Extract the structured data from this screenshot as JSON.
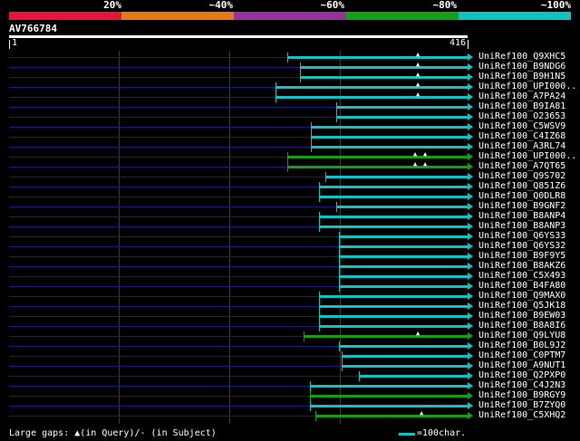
{
  "scale": {
    "labels": [
      "20%",
      "~40%",
      "~60%",
      "~80%",
      "~100%"
    ],
    "colors": [
      "#e8143a",
      "#e87814",
      "#9632a0",
      "#14a014",
      "#0dc3c3"
    ]
  },
  "query": {
    "name": "AV766784",
    "start": "1",
    "end": "416",
    "length": 416
  },
  "hits": [
    {
      "label": "UniRef100_Q9XHC5",
      "start": 252,
      "color": "#0dc3c3",
      "gaps": [
        372
      ]
    },
    {
      "label": "UniRef100_B9NDG6",
      "start": 264,
      "color": "#0dc3c3",
      "gaps": [
        372
      ]
    },
    {
      "label": "UniRef100_B9H1N5",
      "start": 264,
      "color": "#0dc3c3",
      "gaps": [
        372
      ]
    },
    {
      "label": "UniRef100_UPI000..",
      "start": 242,
      "color": "#0dc3c3",
      "gaps": [
        372
      ]
    },
    {
      "label": "UniRef100_A7PA24",
      "start": 242,
      "color": "#0dc3c3",
      "gaps": [
        372
      ]
    },
    {
      "label": "UniRef100_B9IA81",
      "start": 297,
      "color": "#0dc3c3",
      "gaps": []
    },
    {
      "label": "UniRef100_O23653",
      "start": 297,
      "color": "#0dc3c3",
      "gaps": []
    },
    {
      "label": "UniRef100_C5WSV9",
      "start": 274,
      "color": "#0dc3c3",
      "gaps": []
    },
    {
      "label": "UniRef100_C4IZ68",
      "start": 274,
      "color": "#0dc3c3",
      "gaps": []
    },
    {
      "label": "UniRef100_A3RL74",
      "start": 274,
      "color": "#0dc3c3",
      "gaps": []
    },
    {
      "label": "UniRef100_UPI000..",
      "start": 252,
      "color": "#14a014",
      "gaps": [
        369,
        378
      ]
    },
    {
      "label": "UniRef100_A7QT65",
      "start": 252,
      "color": "#14a014",
      "gaps": [
        369,
        378
      ]
    },
    {
      "label": "UniRef100_Q9S702",
      "start": 287,
      "color": "#0dc3c3",
      "gaps": []
    },
    {
      "label": "UniRef100_Q851Z6",
      "start": 281,
      "color": "#0dc3c3",
      "gaps": []
    },
    {
      "label": "UniRef100_Q0DLR8",
      "start": 281,
      "color": "#0dc3c3",
      "gaps": []
    },
    {
      "label": "UniRef100_B9GNF2",
      "start": 297,
      "color": "#0dc3c3",
      "gaps": []
    },
    {
      "label": "UniRef100_B8ANP4",
      "start": 281,
      "color": "#0dc3c3",
      "gaps": []
    },
    {
      "label": "UniRef100_B8ANP3",
      "start": 281,
      "color": "#0dc3c3",
      "gaps": []
    },
    {
      "label": "UniRef100_Q6YS33",
      "start": 299,
      "color": "#0dc3c3",
      "gaps": []
    },
    {
      "label": "UniRef100_Q6YS32",
      "start": 299,
      "color": "#0dc3c3",
      "gaps": []
    },
    {
      "label": "UniRef100_B9F9Y5",
      "start": 299,
      "color": "#0dc3c3",
      "gaps": []
    },
    {
      "label": "UniRef100_B8AKZ6",
      "start": 299,
      "color": "#0dc3c3",
      "gaps": []
    },
    {
      "label": "UniRef100_C5X493",
      "start": 299,
      "color": "#0dc3c3",
      "gaps": []
    },
    {
      "label": "UniRef100_B4FA80",
      "start": 299,
      "color": "#0dc3c3",
      "gaps": []
    },
    {
      "label": "UniRef100_Q9MAX0",
      "start": 281,
      "color": "#0dc3c3",
      "gaps": []
    },
    {
      "label": "UniRef100_Q5JK18",
      "start": 281,
      "color": "#0dc3c3",
      "gaps": []
    },
    {
      "label": "UniRef100_B9EW03",
      "start": 281,
      "color": "#0dc3c3",
      "gaps": []
    },
    {
      "label": "UniRef100_B8A8I6",
      "start": 281,
      "color": "#0dc3c3",
      "gaps": []
    },
    {
      "label": "UniRef100_Q9LYU8",
      "start": 267,
      "color": "#14a014",
      "gaps": [
        372
      ]
    },
    {
      "label": "UniRef100_B0L9J2",
      "start": 299,
      "color": "#0dc3c3",
      "gaps": []
    },
    {
      "label": "UniRef100_C0PTM7",
      "start": 302,
      "color": "#0dc3c3",
      "gaps": []
    },
    {
      "label": "UniRef100_A9NUT1",
      "start": 302,
      "color": "#0dc3c3",
      "gaps": []
    },
    {
      "label": "UniRef100_Q2PXP0",
      "start": 317,
      "color": "#0dc3c3",
      "gaps": []
    },
    {
      "label": "UniRef100_C4J2N3",
      "start": 273,
      "color": "#0dc3c3",
      "gaps": []
    },
    {
      "label": "UniRef100_B9RGY9",
      "start": 273,
      "color": "#14a014",
      "gaps": []
    },
    {
      "label": "UniRef100_B7ZYQ0",
      "start": 273,
      "color": "#0dc3c3",
      "gaps": []
    },
    {
      "label": "UniRef100_C5XHQ2",
      "start": 278,
      "color": "#14a014",
      "gaps": [
        375
      ]
    }
  ],
  "footer": {
    "gaps_legend": "Large gaps: ▲(in Query)/- (in Subject)",
    "scale_legend": "=100char."
  }
}
